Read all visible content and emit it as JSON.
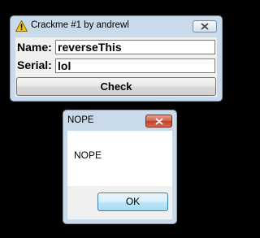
{
  "crackme_window": {
    "title": "Crackme #1 by andrewl",
    "name_label": "Name:",
    "name_value": "reverseThis",
    "serial_label": "Serial:",
    "serial_value": "lol",
    "check_label": "Check",
    "title_icon": "warning-icon",
    "close_icon": "close-icon"
  },
  "message_box": {
    "title": "NOPE",
    "message": "NOPE",
    "ok_label": "OK",
    "close_icon": "close-icon",
    "close_color": "#c2402a"
  }
}
